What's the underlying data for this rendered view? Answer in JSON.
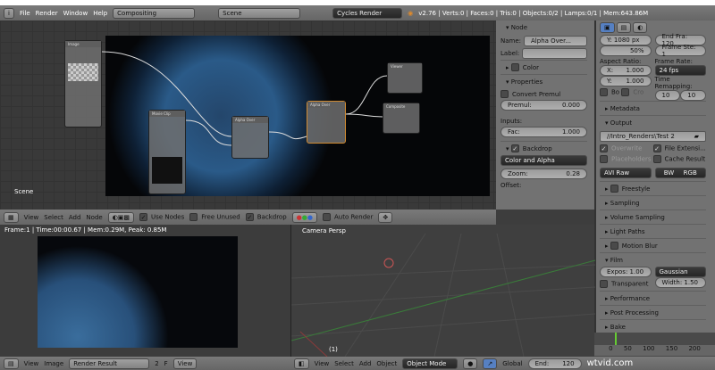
{
  "topbar": {
    "menus": [
      "File",
      "Render",
      "Window",
      "Help"
    ],
    "layout": "Compositing",
    "scene": "Scene",
    "engine": "Cycles Render",
    "stats": "v2.76 | Verts:0 | Faces:0 | Tris:0 | Objects:0/2 | Lamps:0/1 | Mem:643.86M"
  },
  "node_editor": {
    "scene_label": "Scene",
    "nodes": {
      "image": "Image",
      "movieclip": "Movie Clip",
      "alphaover1": "Alpha Over",
      "alphaover2": "Alpha Over",
      "viewer": "Viewer",
      "composite": "Composite"
    },
    "header": {
      "menus": [
        "View",
        "Select",
        "Add",
        "Node"
      ],
      "use_nodes": "Use Nodes",
      "free_unused": "Free Unused",
      "backdrop": "Backdrop",
      "auto_render": "Auto Render"
    }
  },
  "npanel": {
    "node_title": "Node",
    "name_label": "Name:",
    "name_value": "Alpha Over...",
    "label_label": "Label:",
    "color": "Color",
    "properties": "Properties",
    "convert_premul": "Convert Premul",
    "premul_label": "Premul:",
    "premul_value": "0.000",
    "inputs": "Inputs:",
    "fac_label": "Fac:",
    "fac_value": "1.000",
    "backdrop": "Backdrop",
    "channels": "Color and Alpha",
    "zoom_label": "Zoom:",
    "zoom_value": "0.28",
    "offset": "Offset:"
  },
  "props": {
    "res_y": "Y:  1080 px",
    "res_pct": "50%",
    "end_frame": "End Fra: 120",
    "frame_step": "Frame Ste: 1",
    "aspect": "Aspect Ratio:",
    "asp_x": "X:",
    "asp_x_v": "1.000",
    "asp_y": "Y:",
    "asp_y_v": "1.000",
    "frame_rate": "Frame Rate:",
    "fps": "24 fps",
    "time_remap": "Time Remapping:",
    "remap_old": "10",
    "remap_new": "10",
    "border": "Bo",
    "crop": "Cro",
    "metadata": "Metadata",
    "output": "Output",
    "path": "//Intro_Renders\\Test 2",
    "overwrite": "Overwrite",
    "file_ext": "File Extensi...",
    "placeholders": "Placeholders",
    "cache": "Cache Result",
    "format": "AVI Raw",
    "bw": "BW",
    "rgb": "RGB",
    "freestyle": "Freestyle",
    "sampling": "Sampling",
    "volume": "Volume Sampling",
    "light_paths": "Light Paths",
    "motion_blur": "Motion Blur",
    "film": "Film",
    "expos": "Expos: 1.00",
    "filter": "Gaussian",
    "width": "Width: 1.50",
    "transparent": "Transparent",
    "performance": "Performance",
    "post": "Post Processing",
    "bake": "Bake"
  },
  "timeline": {
    "ticks": [
      "0",
      "50",
      "100",
      "150",
      "200"
    ],
    "end": "End:",
    "end_value": "120"
  },
  "image_editor": {
    "info": "Frame:1 | Time:00:00.67 | Mem:0.29M, Peak: 0.85M",
    "menus": [
      "View",
      "Image"
    ],
    "image": "Render Result",
    "slot": "2",
    "f": "F",
    "view": "View"
  },
  "viewport": {
    "label": "Camera Persp",
    "frame": "(1)",
    "menus": [
      "View",
      "Select",
      "Add",
      "Object"
    ],
    "mode": "Object Mode",
    "orientation": "Global"
  },
  "watermark": "wtvid.com"
}
